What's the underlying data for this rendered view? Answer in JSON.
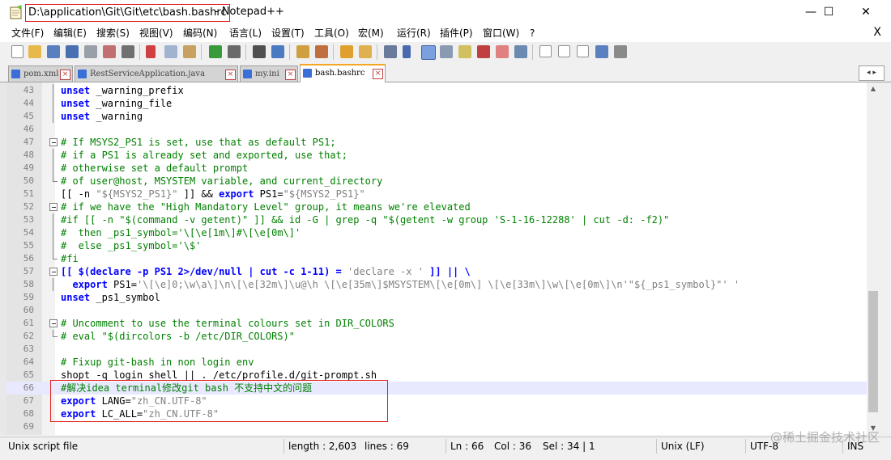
{
  "window": {
    "path": "D:\\application\\Git\\Git\\etc\\bash.bashrc",
    "app": "- Notepad++",
    "minimize": "—",
    "maximize": "☐",
    "close": "✕"
  },
  "menu": [
    "文件(F)",
    "编辑(E)",
    "搜索(S)",
    "视图(V)",
    "编码(N)",
    "语言(L)",
    "设置(T)",
    "工具(O)",
    "宏(M)",
    "运行(R)",
    "插件(P)",
    "窗口(W)",
    "?"
  ],
  "menu_close": "X",
  "tabs": [
    {
      "label": "pom.xml",
      "active": false
    },
    {
      "label": "RestServiceApplication.java",
      "active": false
    },
    {
      "label": "my.ini",
      "active": false
    },
    {
      "label": "bash.bashrc",
      "active": true
    }
  ],
  "tab_arrows": "◂ ▸",
  "lines": [
    {
      "n": "43",
      "fold": "v",
      "segs": [
        {
          "t": "unset",
          "c": "kw"
        },
        {
          "t": " _warning_prefix",
          "c": "pl"
        }
      ]
    },
    {
      "n": "44",
      "fold": "v",
      "segs": [
        {
          "t": "unset",
          "c": "kw"
        },
        {
          "t": " _warning_file",
          "c": "pl"
        }
      ]
    },
    {
      "n": "45",
      "fold": "v",
      "segs": [
        {
          "t": "unset",
          "c": "kw"
        },
        {
          "t": " _warning",
          "c": "pl"
        }
      ]
    },
    {
      "n": "46",
      "fold": "",
      "segs": []
    },
    {
      "n": "47",
      "fold": "box",
      "segs": [
        {
          "t": "# If MSYS2_PS1 is set, use that as default PS1;",
          "c": "cm"
        }
      ]
    },
    {
      "n": "48",
      "fold": "v",
      "segs": [
        {
          "t": "# if a PS1 is already set and exported, use that;",
          "c": "cm"
        }
      ]
    },
    {
      "n": "49",
      "fold": "v",
      "segs": [
        {
          "t": "# otherwise set a default prompt",
          "c": "cm"
        }
      ]
    },
    {
      "n": "50",
      "fold": "end",
      "segs": [
        {
          "t": "# of user@host, MSYSTEM variable, and current_directory",
          "c": "cm"
        }
      ]
    },
    {
      "n": "51",
      "fold": "",
      "segs": [
        {
          "t": "[[ -n ",
          "c": "pl"
        },
        {
          "t": "\"${MSYS2_PS1}\"",
          "c": "st"
        },
        {
          "t": " ]] && ",
          "c": "pl"
        },
        {
          "t": "export",
          "c": "kw"
        },
        {
          "t": " PS1=",
          "c": "pl"
        },
        {
          "t": "\"${MSYS2_PS1}\"",
          "c": "st"
        }
      ]
    },
    {
      "n": "52",
      "fold": "box",
      "segs": [
        {
          "t": "# if we have the \"High Mandatory Level\" group, it means we're elevated",
          "c": "cm"
        }
      ]
    },
    {
      "n": "53",
      "fold": "v",
      "segs": [
        {
          "t": "#if [[ -n \"$(command -v getent)\" ]] && id -G | grep -q \"$(getent -w group 'S-1-16-12288' | cut -d: -f2)\"",
          "c": "cm"
        }
      ]
    },
    {
      "n": "54",
      "fold": "v",
      "segs": [
        {
          "t": "#  then _ps1_symbol='\\[\\e[1m\\]#\\[\\e[0m\\]'",
          "c": "cm"
        }
      ]
    },
    {
      "n": "55",
      "fold": "v",
      "segs": [
        {
          "t": "#  else _ps1_symbol='\\$'",
          "c": "cm"
        }
      ]
    },
    {
      "n": "56",
      "fold": "end",
      "segs": [
        {
          "t": "#fi",
          "c": "cm"
        }
      ]
    },
    {
      "n": "57",
      "fold": "box",
      "segs": [
        {
          "t": "[[ $(declare -p PS1 2>/dev/null | cut -c 1-11) = ",
          "c": "kw"
        },
        {
          "t": "'declare -x '",
          "c": "st"
        },
        {
          "t": " ]] || \\",
          "c": "kw"
        }
      ]
    },
    {
      "n": "58",
      "fold": "v",
      "segs": [
        {
          "t": "  ",
          "c": "pl"
        },
        {
          "t": "export",
          "c": "kw"
        },
        {
          "t": " PS1=",
          "c": "pl"
        },
        {
          "t": "'\\[\\e]0;\\w\\a\\]\\n\\[\\e[32m\\]\\u@\\h \\[\\e[35m\\]$MSYSTEM\\[\\e[0m\\] \\[\\e[33m\\]\\w\\[\\e[0m\\]\\n'\"${_ps1_symbol}\"' '",
          "c": "st"
        }
      ]
    },
    {
      "n": "59",
      "fold": "",
      "segs": [
        {
          "t": "unset",
          "c": "kw"
        },
        {
          "t": " _ps1_symbol",
          "c": "pl"
        }
      ]
    },
    {
      "n": "60",
      "fold": "",
      "segs": []
    },
    {
      "n": "61",
      "fold": "box",
      "segs": [
        {
          "t": "# Uncomment to use the terminal colours set in DIR_COLORS",
          "c": "cm"
        }
      ]
    },
    {
      "n": "62",
      "fold": "end",
      "segs": [
        {
          "t": "# eval \"$(dircolors -b /etc/DIR_COLORS)\"",
          "c": "cm"
        }
      ]
    },
    {
      "n": "63",
      "fold": "",
      "segs": []
    },
    {
      "n": "64",
      "fold": "",
      "segs": [
        {
          "t": "# Fixup git-bash in non login env",
          "c": "cm"
        }
      ]
    },
    {
      "n": "65",
      "fold": "",
      "segs": [
        {
          "t": "shopt -q login_shell || . /etc/profile.d/git-prompt.sh",
          "c": "pl"
        }
      ]
    },
    {
      "n": "66",
      "fold": "",
      "current": true,
      "segs": [
        {
          "t": "#解决idea terminal修改git bash 不支持中文的问题",
          "c": "cm"
        }
      ]
    },
    {
      "n": "67",
      "fold": "",
      "segs": [
        {
          "t": "export",
          "c": "kw"
        },
        {
          "t": " LANG=",
          "c": "pl"
        },
        {
          "t": "\"zh_CN.UTF-8\"",
          "c": "st"
        }
      ]
    },
    {
      "n": "68",
      "fold": "",
      "segs": [
        {
          "t": "export",
          "c": "kw"
        },
        {
          "t": " LC_ALL=",
          "c": "pl"
        },
        {
          "t": "\"zh_CN.UTF-8\"",
          "c": "st"
        }
      ]
    },
    {
      "n": "69",
      "fold": "",
      "segs": []
    }
  ],
  "status": {
    "type": "Unix script file",
    "length": "length : 2,603",
    "lines": "lines : 69",
    "ln": "Ln : 66",
    "col": "Col : 36",
    "sel": "Sel : 34 | 1",
    "eol": "Unix (LF)",
    "encoding": "UTF-8",
    "mode": "INS"
  },
  "watermark": "@稀土掘金技术社区"
}
